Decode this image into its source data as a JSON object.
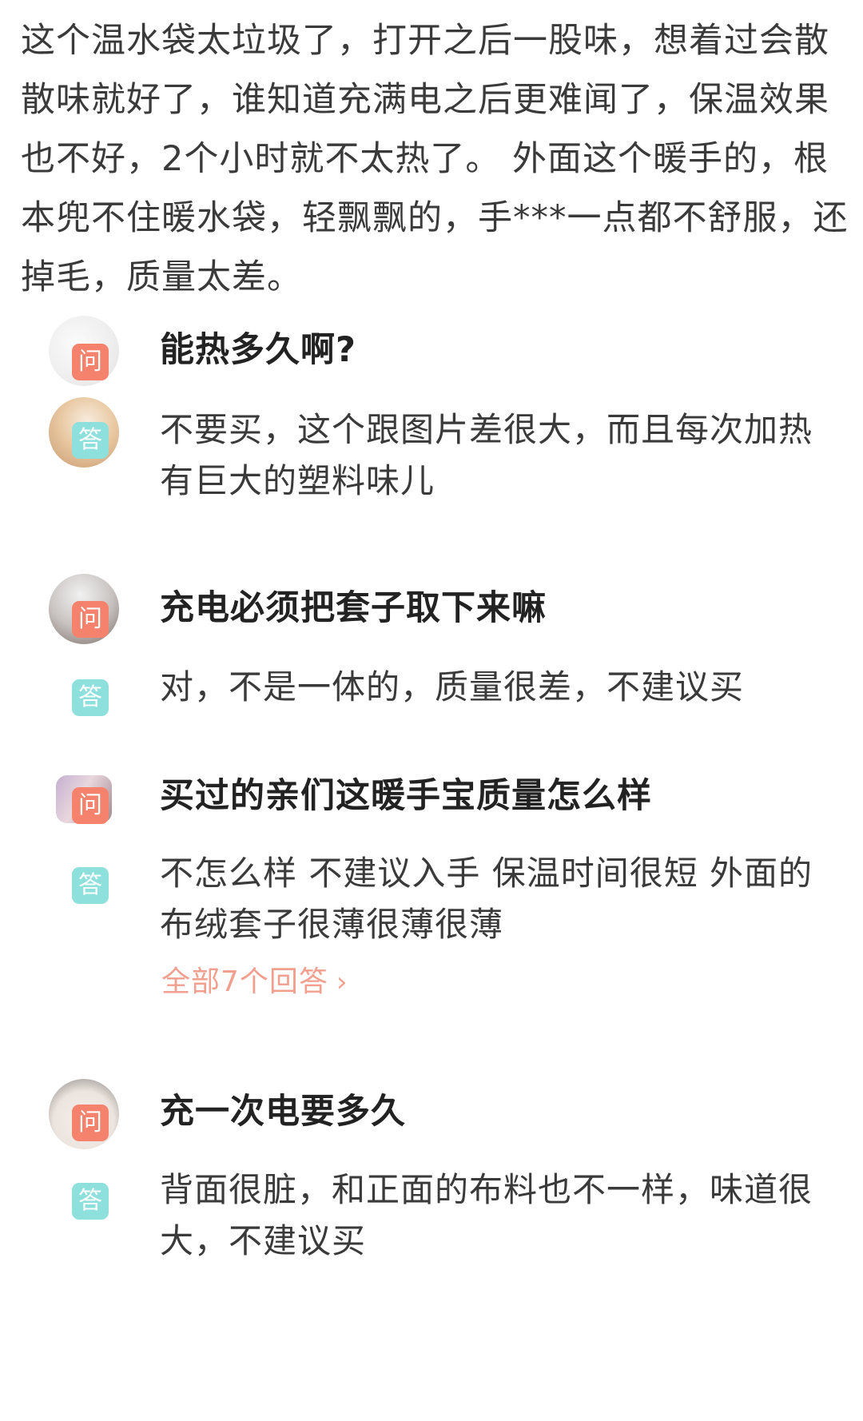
{
  "review": {
    "text": "这个温水袋太垃圾了，打开之后一股味，想着过会散散味就好了，谁知道充满电之后更难闻了，保温效果也不好，2个小时就不太热了。 外面这个暖手的，根本兜不住暖水袋，轻飘飘的，手***一点都不舒服，还掉毛，质量太差。"
  },
  "badges": {
    "ask": "问",
    "answer": "答"
  },
  "qa": [
    {
      "question": "能热多久啊?",
      "answer": "不要买，这个跟图片差很大，而且每次加热有巨大的塑料味儿"
    },
    {
      "question": "充电必须把套子取下来嘛",
      "answer": "对，不是一体的，质量很差，不建议买"
    },
    {
      "question": "买过的亲们这暖手宝质量怎么样",
      "answer": "不怎么样  不建议入手   保温时间很短   外面的布绒套子很薄很薄很薄",
      "more": "全部7个回答"
    },
    {
      "question": "充一次电要多久",
      "answer": "背面很脏，和正面的布料也不一样，味道很大，不建议买"
    }
  ],
  "icons": {
    "more_arrow": "chevron-right-icon"
  },
  "colors": {
    "ask_badge": "#f5826d",
    "answer_badge": "#8ee0dd",
    "link": "#f1a08f"
  }
}
